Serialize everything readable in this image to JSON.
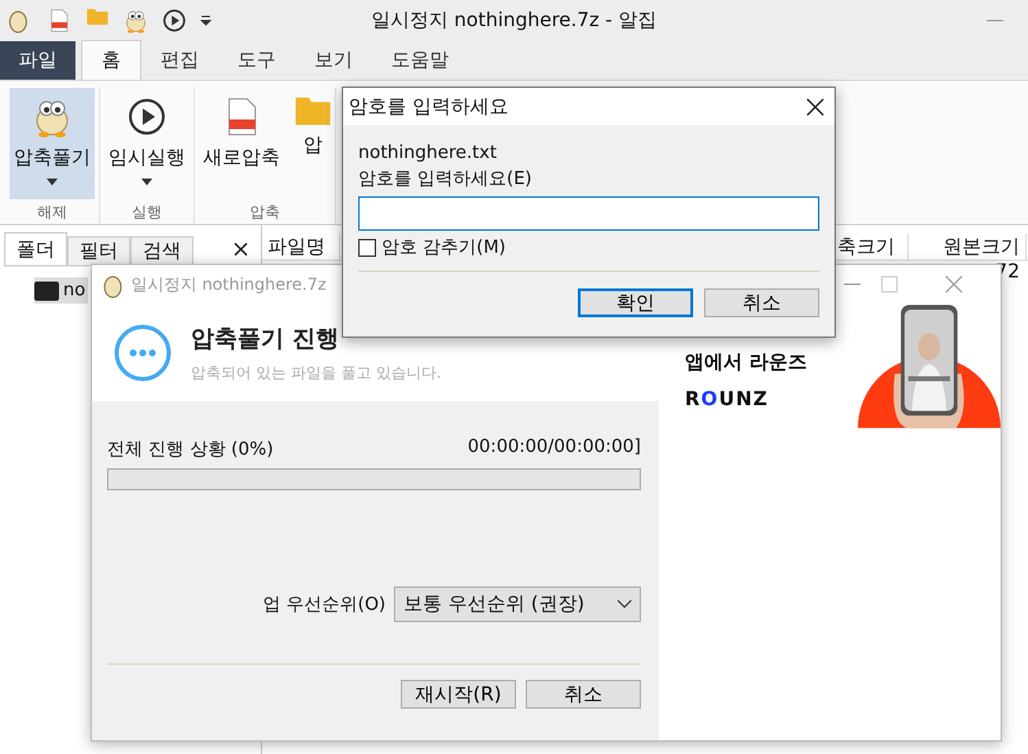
{
  "main_window": {
    "title": "일시정지 nothinghere.7z - 알집",
    "menu_tabs": [
      {
        "label": "파일",
        "kind": "file",
        "selected": false
      },
      {
        "label": "홈",
        "kind": "tab",
        "selected": true
      },
      {
        "label": "편집",
        "kind": "tab",
        "selected": false
      },
      {
        "label": "도구",
        "kind": "tab",
        "selected": false
      },
      {
        "label": "보기",
        "kind": "tab",
        "selected": false
      },
      {
        "label": "도움말",
        "kind": "tab",
        "selected": false
      }
    ],
    "ribbon_groups": [
      {
        "label": "해제",
        "buttons": [
          {
            "label": "압축풀기",
            "kind": "mascot",
            "selected": true,
            "dropdown": true
          }
        ]
      },
      {
        "label": "실행",
        "buttons": [
          {
            "label": "임시실행",
            "kind": "play",
            "selected": false,
            "dropdown": true
          }
        ]
      },
      {
        "label": "압축",
        "buttons": [
          {
            "label": "새로압축",
            "kind": "zip",
            "selected": false,
            "dropdown": false
          },
          {
            "label": "압",
            "kind": "folder",
            "selected": false,
            "dropdown": false
          }
        ]
      }
    ],
    "panel_tabs": [
      {
        "label": "폴더",
        "selected": true
      },
      {
        "label": "필터",
        "selected": false
      },
      {
        "label": "검색",
        "selected": false
      }
    ],
    "tree": [
      {
        "label": "no",
        "selected": true
      }
    ],
    "file_list": {
      "columns": [
        "파일명",
        "축크기",
        "원본크기"
      ],
      "rows": [
        {
          "original_size": "72"
        }
      ]
    }
  },
  "progress_window": {
    "title": "일시정지 nothinghere.7z",
    "heading": "압축풀기 진행",
    "subtitle": "압축되어 있는 파일을 풀고 있습니다.",
    "progress_label": "전체 진행 상황 (0%)",
    "time": "00:00:00/00:00:00]",
    "level": 0,
    "priority_label": "업 우선순위(O)",
    "priority_value": "보통 우선순위 (권장)",
    "buttons": [
      "재시작(R)",
      "취소"
    ],
    "ad": {
      "headline": "앱에서 라운즈",
      "logo": "ROUNZ"
    }
  },
  "password_dialog": {
    "title": "암호를 입력하세요",
    "file": "nothinghere.txt",
    "prompt": "암호를 입력하세요(E)",
    "hide_password": {
      "label": "암호 감추기(M)",
      "checked": false
    },
    "buttons": [
      {
        "label": "확인",
        "default": true
      },
      {
        "label": "취소",
        "default": false
      }
    ]
  }
}
